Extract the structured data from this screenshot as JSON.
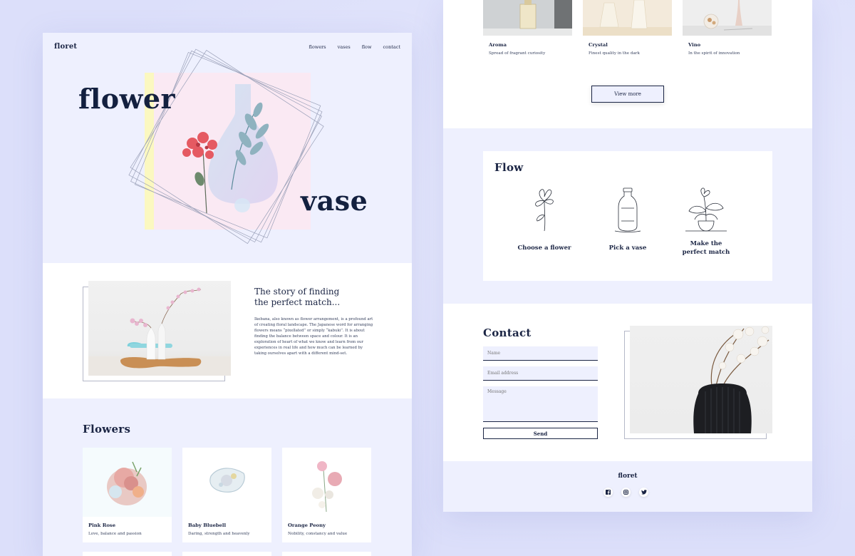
{
  "nav": {
    "logo": "floret",
    "links": [
      "flowers",
      "vases",
      "flow",
      "contact"
    ]
  },
  "hero": {
    "word1": "flower",
    "word2": "vase"
  },
  "story": {
    "title_line1": "The story of finding",
    "title_line2": "the perfect match...",
    "body": "Ikebana, also known as flower arrangement, is a profound art of creating floral landscape. The Japanese word for arranging flowers means “pixellated” or simply “kabuki”. It is about finding the balance between space and colour. It is an exploration of heart of what we know and learn from our experiences in real life and how much can be learned by taking ourselves apart with a different mind-set."
  },
  "flowers": {
    "title": "Flowers",
    "items": [
      {
        "name": "Pink Rose",
        "desc": "Love, balance and passion"
      },
      {
        "name": "Baby Bluebell",
        "desc": "Daring, strength and heavenly"
      },
      {
        "name": "Orange Peony",
        "desc": "Nobility, constancy and value"
      }
    ]
  },
  "vases": {
    "items": [
      {
        "name": "Aroma",
        "desc": "Spread of fragrant curiosity"
      },
      {
        "name": "Crystal",
        "desc": "Finest quality in the dark"
      },
      {
        "name": "Vino",
        "desc": "In the spirit of innovation"
      }
    ],
    "view_more": "View more"
  },
  "flow": {
    "title": "Flow",
    "steps": [
      {
        "label_line1": "Choose a flower",
        "label_line2": ""
      },
      {
        "label_line1": "Pick a vase",
        "label_line2": ""
      },
      {
        "label_line1": "Make the",
        "label_line2": "perfect match"
      }
    ]
  },
  "contact": {
    "title": "Contact",
    "name_placeholder": "Name",
    "email_placeholder": "Email address",
    "message_placeholder": "Message",
    "send_label": "Send"
  },
  "footer": {
    "logo": "floret",
    "socials": [
      "facebook-icon",
      "instagram-icon",
      "twitter-icon"
    ]
  },
  "colors": {
    "navy": "#1b2544",
    "pink": "#fae9f3",
    "yellow": "#fbf8c0",
    "page_bg": "#eef0fe",
    "backdrop": "#dfe2fb"
  }
}
